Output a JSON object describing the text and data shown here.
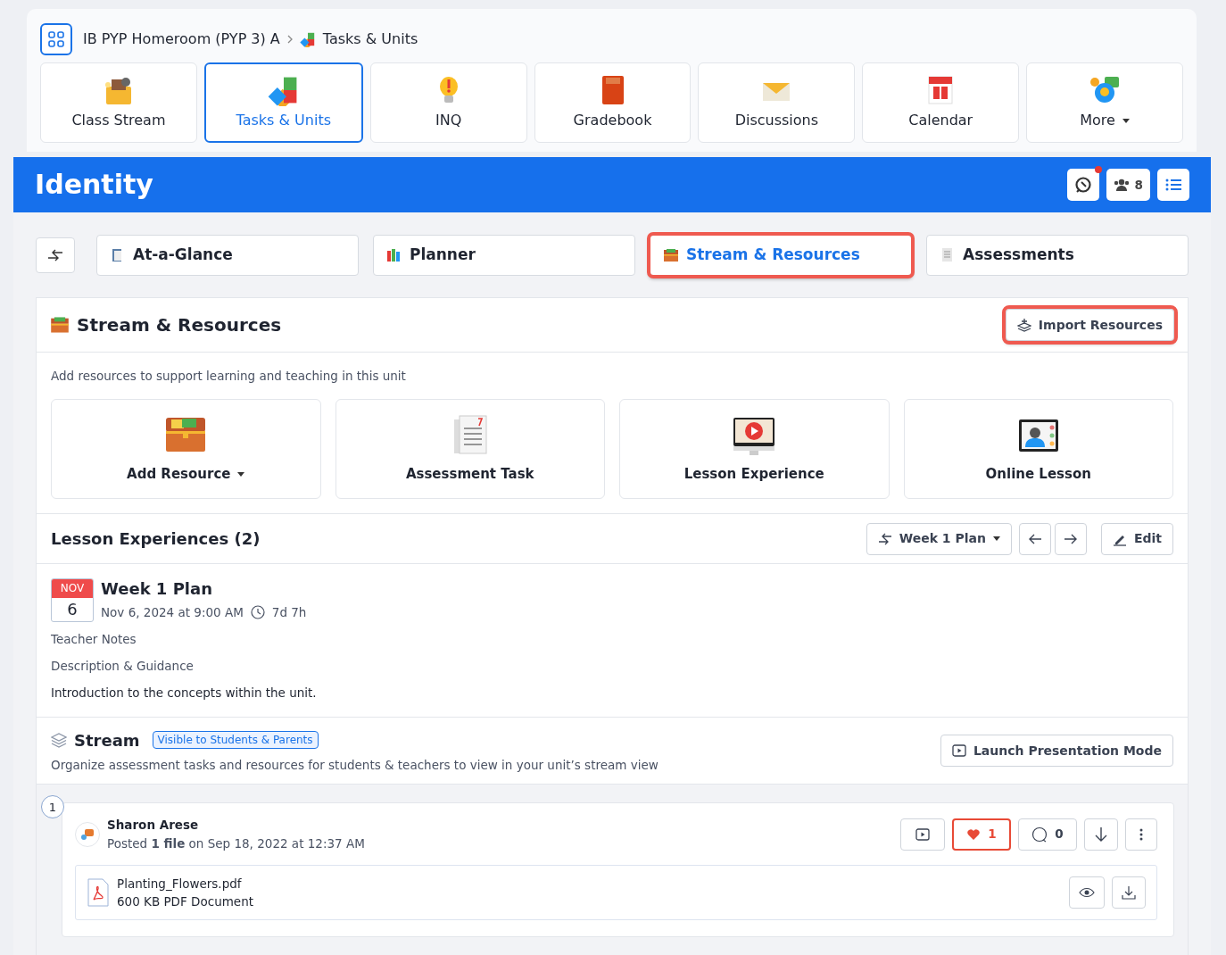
{
  "breadcrumb": [
    {
      "label": "IB PYP Homeroom (PYP 3) A"
    },
    {
      "label": "Tasks & Units"
    }
  ],
  "apps": [
    {
      "label": "Class Stream",
      "selected": false,
      "dropdown": false
    },
    {
      "label": "Tasks & Units",
      "selected": true,
      "dropdown": false
    },
    {
      "label": "INQ",
      "selected": false,
      "dropdown": false
    },
    {
      "label": "Gradebook",
      "selected": false,
      "dropdown": false
    },
    {
      "label": "Discussions",
      "selected": false,
      "dropdown": false
    },
    {
      "label": "Calendar",
      "selected": false,
      "dropdown": false
    },
    {
      "label": "More",
      "selected": false,
      "dropdown": true
    }
  ],
  "unit": {
    "title": "Identity",
    "chat_unread": true,
    "members": "8"
  },
  "unit_tabs": [
    {
      "label": "At-a-Glance",
      "selected": false,
      "highlighted": false
    },
    {
      "label": "Planner",
      "selected": false,
      "highlighted": false
    },
    {
      "label": "Stream & Resources",
      "selected": true,
      "highlighted": true
    },
    {
      "label": "Assessments",
      "selected": false,
      "highlighted": false
    }
  ],
  "resources": {
    "title": "Stream & Resources",
    "import_button": {
      "label": "Import Resources",
      "highlighted": true
    },
    "intro": "Add resources to support learning and teaching in this unit",
    "cards": [
      {
        "label": "Add Resource",
        "dropdown": true
      },
      {
        "label": "Assessment Task",
        "dropdown": false
      },
      {
        "label": "Lesson Experience",
        "dropdown": false
      },
      {
        "label": "Online Lesson",
        "dropdown": false
      }
    ]
  },
  "lessons": {
    "title": "Lesson Experiences (2)",
    "plan_select": "Week 1 Plan",
    "edit": "Edit",
    "event": {
      "month": "NOV",
      "day": "6",
      "title": "Week 1 Plan",
      "datetime": "Nov 6, 2024 at 9:00 AM",
      "duration": "7d 7h"
    },
    "notes": [
      "Teacher Notes",
      "Description & Guidance",
      "Introduction to the concepts within the unit."
    ]
  },
  "stream": {
    "title": "Stream",
    "badge": "Visible to Students & Parents",
    "description": "Organize assessment tasks and resources for students & teachers to view in your unit’s stream view",
    "launch": "Launch Presentation Mode",
    "post": {
      "number": "1",
      "author": "Sharon Arese",
      "posted": "Posted **1 file** on Sep 18, 2022 at 12:37 AM",
      "likes": "1",
      "liked": true,
      "comments": "0",
      "file": {
        "name": "Planting_Flowers.pdf",
        "meta": "600 KB PDF Document"
      }
    }
  }
}
